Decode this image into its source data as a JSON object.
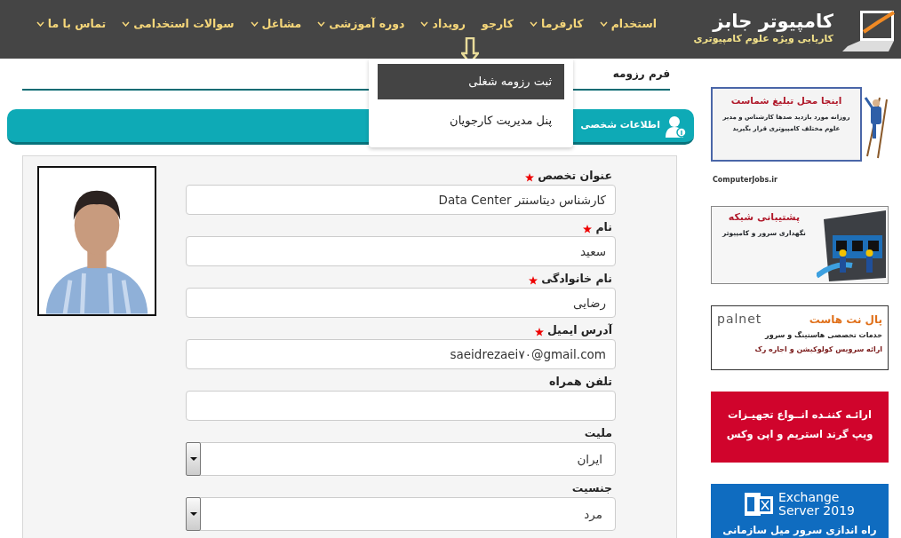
{
  "logo": {
    "title": "کامپیوتر جابز",
    "subtitle": "کاریابی ویژه علوم کامپیوتری"
  },
  "nav": [
    {
      "label": "استخدام",
      "expanded": false
    },
    {
      "label": "کارفرما",
      "expanded": false
    },
    {
      "label": "کارجو",
      "expanded": true
    },
    {
      "label": "رویداد",
      "expanded": false
    },
    {
      "label": "دوره آموزشی",
      "expanded": false
    },
    {
      "label": "مشاغل",
      "expanded": false
    },
    {
      "label": "سوالات استخدامی",
      "expanded": false
    },
    {
      "label": "تماس با ما",
      "expanded": false
    }
  ],
  "dropdown": [
    {
      "label": "ثبت رزومه شغلی",
      "selected": true
    },
    {
      "label": "پنل مدیریت کارجویان",
      "selected": false
    }
  ],
  "page_title": "فرم رزومه",
  "section_title": "اطلاعات شخصی",
  "fields": [
    {
      "label": "عنوان تخصص",
      "required": true,
      "kind": "text",
      "value": "کارشناس دیتاسنتر Data Center"
    },
    {
      "label": "نام",
      "required": true,
      "kind": "text",
      "value": "سعید"
    },
    {
      "label": "نام خانوادگی",
      "required": true,
      "kind": "text",
      "value": "رضایی"
    },
    {
      "label": "آدرس ایمیل",
      "required": true,
      "kind": "text",
      "value": "saeidrezaei۷۰@gmail.com"
    },
    {
      "label": "تلفن همراه",
      "required": false,
      "kind": "text"
    },
    {
      "label": "ملیت",
      "required": false,
      "kind": "select",
      "value": "ایران"
    },
    {
      "label": "جنسیت",
      "required": false,
      "kind": "select",
      "value": "مرد"
    }
  ],
  "ads": [
    {
      "kind": "billboard",
      "title": "اینجا محل تبلیغ شماست",
      "lines": [
        "روزانه مورد بازدید صدها کارشناس و مدیر",
        "علوم مختلف کامپیوتری قرار بگیرید"
      ],
      "footer": "ComputerJobs.ir"
    },
    {
      "kind": "network",
      "title": "پشتیبانی شبکه",
      "lines": [
        "نگهداری سرور و کامپیوتر"
      ]
    },
    {
      "kind": "hosting",
      "brand": "palnet",
      "title": "پال نت هاست",
      "lines": [
        "خدمات تخصصی هاستینگ و سرور",
        "ارائه سرویس کولوکیشن و اجاره رک"
      ]
    },
    {
      "kind": "red",
      "lines": [
        "ارائـه کننـده انــواع تجهیـزات",
        "ویپ گرند استریم و اپن وکس"
      ]
    },
    {
      "kind": "exchange",
      "brand_lines": [
        "Exchange",
        "Server 2019"
      ],
      "lines": [
        "راه اندازی سرور میل سازمانی"
      ]
    }
  ]
}
